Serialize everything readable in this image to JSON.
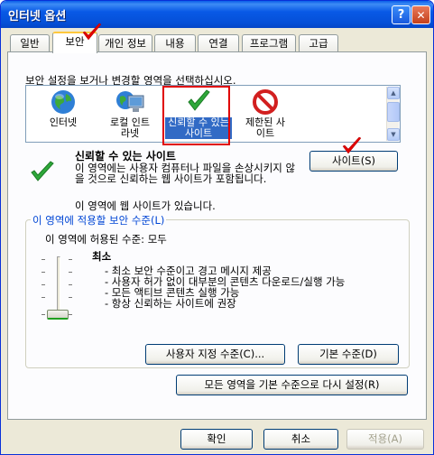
{
  "window": {
    "title": "인터넷 옵션",
    "help_glyph": "?",
    "close_glyph": "✕"
  },
  "tabs": [
    "일반",
    "보안",
    "개인 정보",
    "내용",
    "연결",
    "프로그램",
    "고급"
  ],
  "active_tab": "보안",
  "security": {
    "instruction": "보안 설정을 보거나 변경할 영역을 선택하십시오.",
    "zones": [
      {
        "label": "인터넷",
        "icon": "globe-icon"
      },
      {
        "label": "로컬 인트라넷",
        "icon": "monitor-globe-icon"
      },
      {
        "label": "신뢰할 수 있는 사이트",
        "icon": "green-check-icon"
      },
      {
        "label": "제한된 사이트",
        "icon": "no-entry-icon"
      }
    ],
    "selected_zone": "신뢰할 수 있는 사이트",
    "zone_title": "신뢰할 수 있는 사이트",
    "zone_desc": "이 영역에는 사용자 컴퓨터나 파일을 손상시키지 않을 것으로 신뢰하는 웹 사이트가 포함됩니다.",
    "zone_desc2": "이 영역에 웹 사이트가 있습니다.",
    "sites_button": "사이트(S)",
    "group_label": "이 영역에 적용할 보안 수준(L)",
    "allowed_levels": "이 영역에 허용된 수준: 모두",
    "level_name": "최소",
    "level_points": [
      "- 최소 보안 수준이고 경고 메시지 제공",
      "- 사용자 허가 없이 대부분의 콘텐츠 다운로드/실행 가능",
      "- 모든 액티브 콘텐츠 실행 가능",
      "- 항상 신뢰하는 사이트에 권장"
    ],
    "slider_level": 0,
    "custom_button": "사용자 지정 수준(C)...",
    "default_button": "기본 수준(D)",
    "reset_all_button": "모든 영역을 기본 수준으로 다시 설정(R)"
  },
  "footer": {
    "ok": "확인",
    "cancel": "취소",
    "apply": "적용(A)"
  },
  "colors": {
    "title_blue": "#0550D8",
    "selection": "#316AC5",
    "annotation_red": "#E00000",
    "group_label": "#0046D5"
  }
}
